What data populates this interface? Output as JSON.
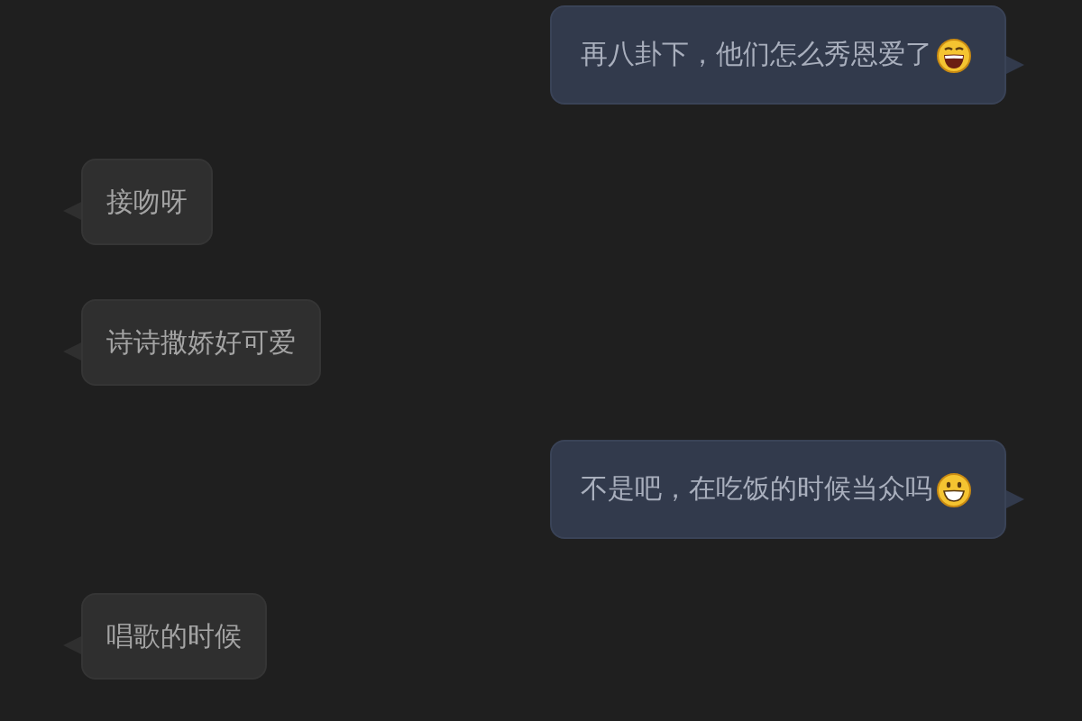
{
  "messages": [
    {
      "kind": "sent",
      "text": "再八卦下，他们怎么秀恩爱了",
      "emoji": {
        "kind": "laughing"
      }
    },
    {
      "kind": "received",
      "text": "接吻呀"
    },
    {
      "kind": "received",
      "text": "诗诗撒娇好可爱"
    },
    {
      "kind": "sent",
      "text": "不是吧，在吃饭的时候当众吗",
      "emoji": {
        "kind": "grinning"
      }
    },
    {
      "kind": "received",
      "text": "唱歌的时候"
    }
  ]
}
